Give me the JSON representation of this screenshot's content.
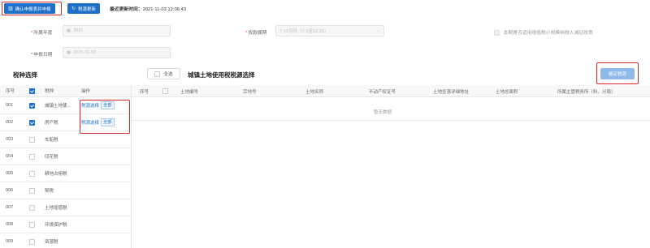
{
  "toolbar": {
    "confirm_submit_label": "确认申报表并申报",
    "refresh_source_label": "税源更新",
    "last_update_label": "最近更新时间：",
    "last_update_value": "2021-11-03 12:06:43"
  },
  "form": {
    "year_label": "所属年度",
    "year_value": "2021",
    "period_label": "按款属期",
    "period_value": "7-12月份（7-1至12-31）",
    "small_taxpayer_label": "本期是否适用增值税小规模纳税人减征政策",
    "declare_date_label": "申报日期",
    "declare_date_value": "2021-11-03"
  },
  "left": {
    "title": "税种选择",
    "headers": {
      "no": "序号",
      "name": "税种",
      "op": "操作"
    },
    "rows": [
      {
        "no": "001",
        "name": "城镇土地使...",
        "checked": true,
        "op_link": "税源选择",
        "op_all": "全部"
      },
      {
        "no": "002",
        "name": "房产税",
        "checked": true,
        "op_link": "税源选择",
        "op_all": "全部"
      },
      {
        "no": "003",
        "name": "车船税",
        "checked": false
      },
      {
        "no": "004",
        "name": "印花税",
        "checked": false
      },
      {
        "no": "005",
        "name": "耕地占用税",
        "checked": false
      },
      {
        "no": "006",
        "name": "契税",
        "checked": false
      },
      {
        "no": "007",
        "name": "土地增值税",
        "checked": false
      },
      {
        "no": "008",
        "name": "环境保护税",
        "checked": false
      },
      {
        "no": "009",
        "name": "资源税",
        "checked": false
      }
    ]
  },
  "right": {
    "select_all_label": "全选",
    "title": "城镇土地使用税税源选择",
    "confirm_label": "确定税源",
    "headers": {
      "no": "序号",
      "land_no": "土地编号",
      "parcel_no": "宗地号",
      "land_name": "土地名称",
      "cert_no": "不动产权证号",
      "address": "土地坐落详细地址",
      "area": "土地总面积",
      "authority": "所属主管税务所（科、分局）"
    },
    "empty_text": "暂无数据"
  },
  "colors": {
    "primary": "#1c70c9",
    "highlight_box": "#d7262a",
    "confirm_disabled": "#8fb9e8"
  }
}
